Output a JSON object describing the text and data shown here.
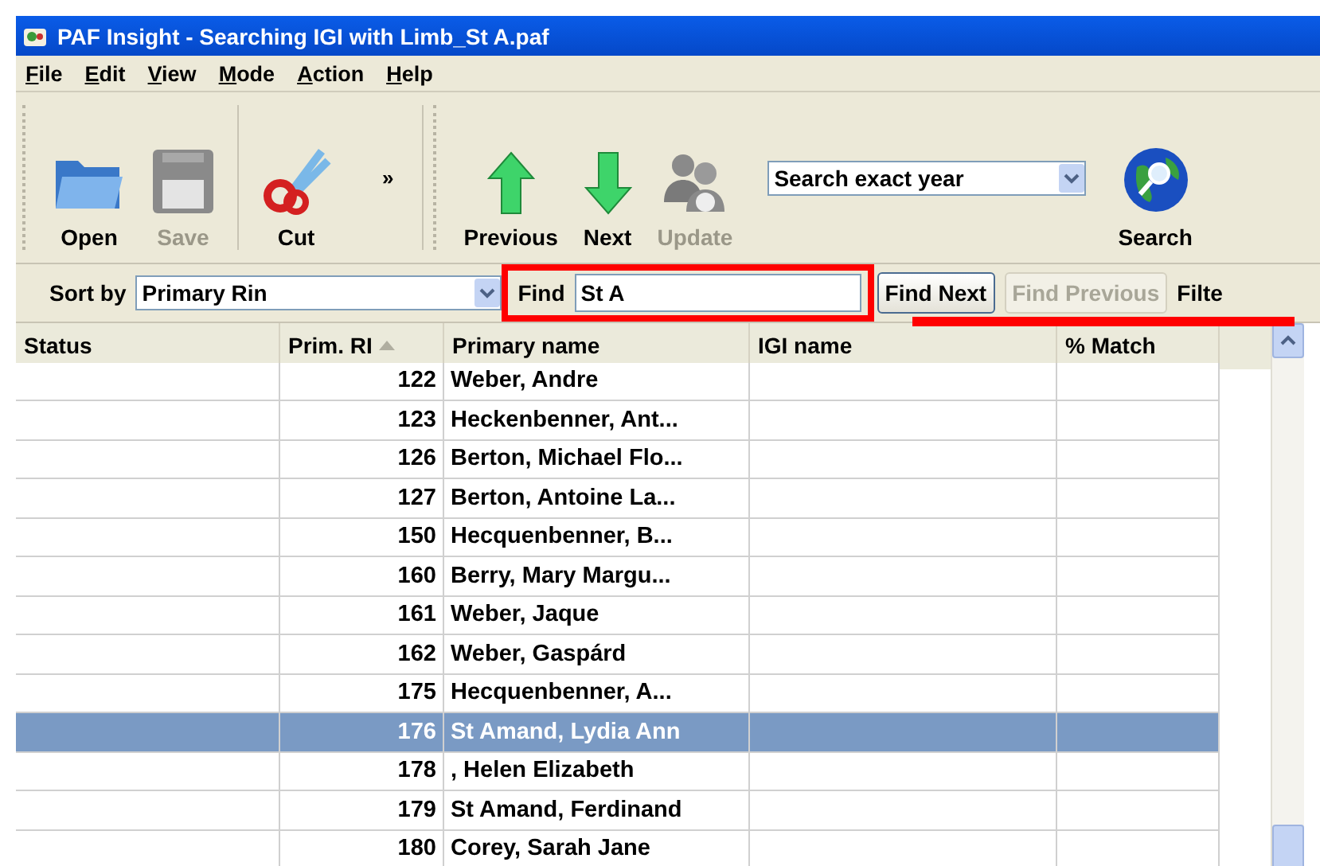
{
  "window": {
    "title": "PAF Insight - Searching IGI with Limb_St A.paf"
  },
  "menu": [
    "File",
    "Edit",
    "View",
    "Mode",
    "Action",
    "Help"
  ],
  "toolbar": {
    "left": [
      {
        "kind": "open",
        "label": "Open",
        "disabled": false
      },
      {
        "kind": "save",
        "label": "Save",
        "disabled": true
      },
      {
        "kind": "cut",
        "label": "Cut",
        "disabled": false
      }
    ],
    "overflow": "»",
    "right": [
      {
        "kind": "previous",
        "label": "Previous",
        "disabled": false
      },
      {
        "kind": "next",
        "label": "Next",
        "disabled": false
      },
      {
        "kind": "update",
        "label": "Update",
        "disabled": true
      }
    ],
    "search_mode": "Search exact year",
    "search": {
      "kind": "search",
      "label": "Search",
      "disabled": false
    }
  },
  "find_bar": {
    "sort_label": "Sort by",
    "sort_value": "Primary Rin",
    "find_label": "Find",
    "find_value": "St A",
    "buttons": [
      {
        "label": "Find Next",
        "disabled": false
      },
      {
        "label": "Find Previous",
        "disabled": true
      }
    ],
    "filter_label": "Filte"
  },
  "table": {
    "columns": [
      "Status",
      "Prim. RI",
      "Primary name",
      "IGI name",
      "% Match"
    ],
    "rows": [
      {
        "rin": "122",
        "name": "Weber, Andre",
        "selected": false
      },
      {
        "rin": "123",
        "name": "Heckenbenner, Ant...",
        "selected": false
      },
      {
        "rin": "126",
        "name": "Berton, Michael Flo...",
        "selected": false
      },
      {
        "rin": "127",
        "name": "Berton, Antoine La...",
        "selected": false
      },
      {
        "rin": "150",
        "name": "Hecquenbenner, B...",
        "selected": false
      },
      {
        "rin": "160",
        "name": "Berry, Mary Margu...",
        "selected": false
      },
      {
        "rin": "161",
        "name": "Weber, Jaque",
        "selected": false
      },
      {
        "rin": "162",
        "name": "Weber, Gaspárd",
        "selected": false
      },
      {
        "rin": "175",
        "name": "Hecquenbenner, A...",
        "selected": false
      },
      {
        "rin": "176",
        "name": "St Amand, Lydia Ann",
        "selected": true
      },
      {
        "rin": "178",
        "name": ", Helen Elizabeth",
        "selected": false
      },
      {
        "rin": "179",
        "name": "St Amand, Ferdinand",
        "selected": false
      },
      {
        "rin": "180",
        "name": "Corey, Sarah Jane",
        "selected": false
      }
    ]
  }
}
